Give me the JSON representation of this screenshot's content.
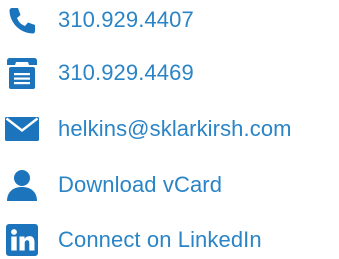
{
  "colors": {
    "icon": "#1c75bc",
    "text": "#2a84c6"
  },
  "contacts": [
    {
      "icon": "phone-icon",
      "label": "310.929.4407"
    },
    {
      "icon": "fax-icon",
      "label": "310.929.4469"
    },
    {
      "icon": "email-icon",
      "label": "helkins@sklarkirsh.com"
    },
    {
      "icon": "person-icon",
      "label": "Download vCard"
    },
    {
      "icon": "linkedin-icon",
      "label": "Connect on LinkedIn"
    }
  ]
}
